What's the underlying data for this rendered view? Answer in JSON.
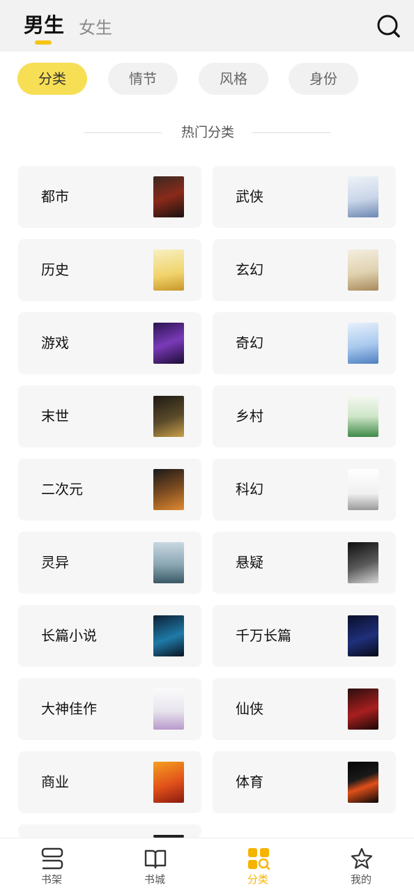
{
  "header": {
    "tabs": [
      {
        "label": "男生",
        "active": true
      },
      {
        "label": "女生",
        "active": false
      }
    ],
    "search_icon": "search-icon",
    "accent_color": "#f5c518"
  },
  "filters": [
    {
      "label": "分类",
      "active": true
    },
    {
      "label": "情节",
      "active": false
    },
    {
      "label": "风格",
      "active": false
    },
    {
      "label": "身份",
      "active": false
    }
  ],
  "section": {
    "title": "热门分类"
  },
  "categories": [
    {
      "label": "都市",
      "cover": "dark-red"
    },
    {
      "label": "武侠",
      "cover": "white-blue"
    },
    {
      "label": "历史",
      "cover": "yellow-ink"
    },
    {
      "label": "玄幻",
      "cover": "beige-warrior"
    },
    {
      "label": "游戏",
      "cover": "purple"
    },
    {
      "label": "奇幻",
      "cover": "light-blue"
    },
    {
      "label": "末世",
      "cover": "dark-gold"
    },
    {
      "label": "乡村",
      "cover": "green-white"
    },
    {
      "label": "二次元",
      "cover": "dark-orange"
    },
    {
      "label": "科幻",
      "cover": "white-grey"
    },
    {
      "label": "灵异",
      "cover": "grey-blue"
    },
    {
      "label": "悬疑",
      "cover": "black-white"
    },
    {
      "label": "长篇小说",
      "cover": "cyan-dark"
    },
    {
      "label": "千万长篇",
      "cover": "navy"
    },
    {
      "label": "大神佳作",
      "cover": "white-portrait"
    },
    {
      "label": "仙侠",
      "cover": "red-dark"
    },
    {
      "label": "商业",
      "cover": "orange-red"
    },
    {
      "label": "体育",
      "cover": "black-fire"
    }
  ],
  "bottom_nav": [
    {
      "label": "书架",
      "icon": "bookshelf-icon",
      "active": false
    },
    {
      "label": "书城",
      "icon": "book-icon",
      "active": false
    },
    {
      "label": "分类",
      "icon": "category-icon",
      "active": true
    },
    {
      "label": "我的",
      "icon": "star-icon",
      "active": false
    }
  ],
  "colors": {
    "accent": "#f5c518",
    "nav_active": "#f5b400",
    "card_bg": "#f6f6f6"
  }
}
